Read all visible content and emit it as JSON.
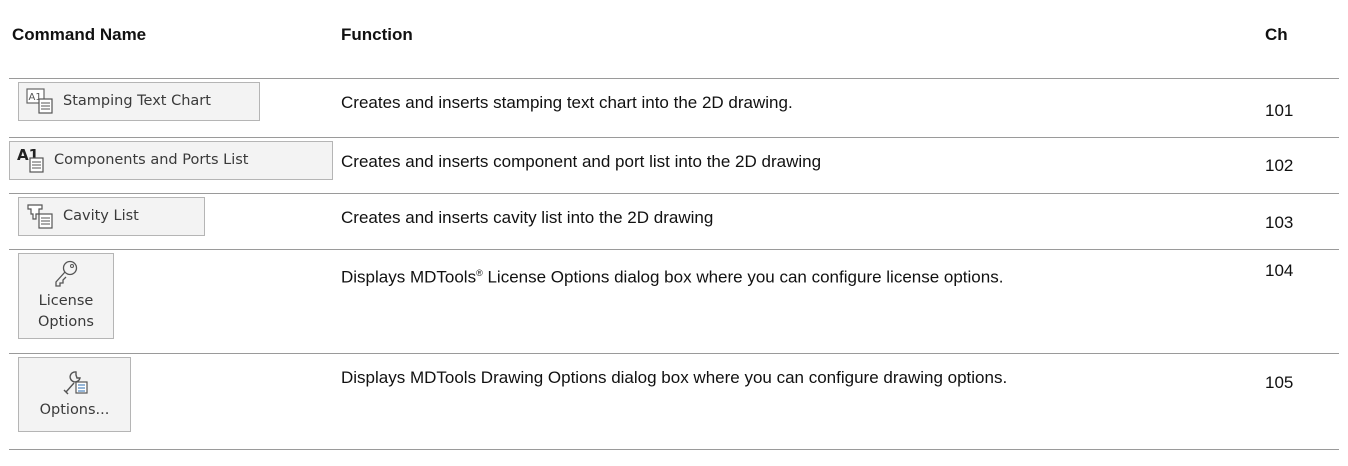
{
  "header": {
    "command_name": "Command Name",
    "function": "Function",
    "ch": "Ch"
  },
  "rows": [
    {
      "button_label": "Stamping Text Chart",
      "icon": "stamping-text-chart-icon",
      "function": "Creates and inserts stamping text chart into the 2D drawing.",
      "ch": "101"
    },
    {
      "button_label": "Components and Ports List",
      "icon": "components-ports-list-icon",
      "function": "Creates and inserts component and port list into the 2D drawing",
      "ch": "102"
    },
    {
      "button_label": "Cavity List",
      "icon": "cavity-list-icon",
      "function": "Creates and inserts cavity list into the 2D drawing",
      "ch": "103"
    },
    {
      "button_label_1": "License",
      "button_label_2": "Options",
      "icon": "key-icon",
      "function_pre": "Displays MDTools",
      "function_sup": "®",
      "function_post": " License Options dialog box where you can configure license options.",
      "ch": "104"
    },
    {
      "button_label": "Options...",
      "icon": "wrench-icon",
      "function": "Displays MDTools Drawing Options dialog box where you can configure drawing options.",
      "ch": "105"
    }
  ]
}
